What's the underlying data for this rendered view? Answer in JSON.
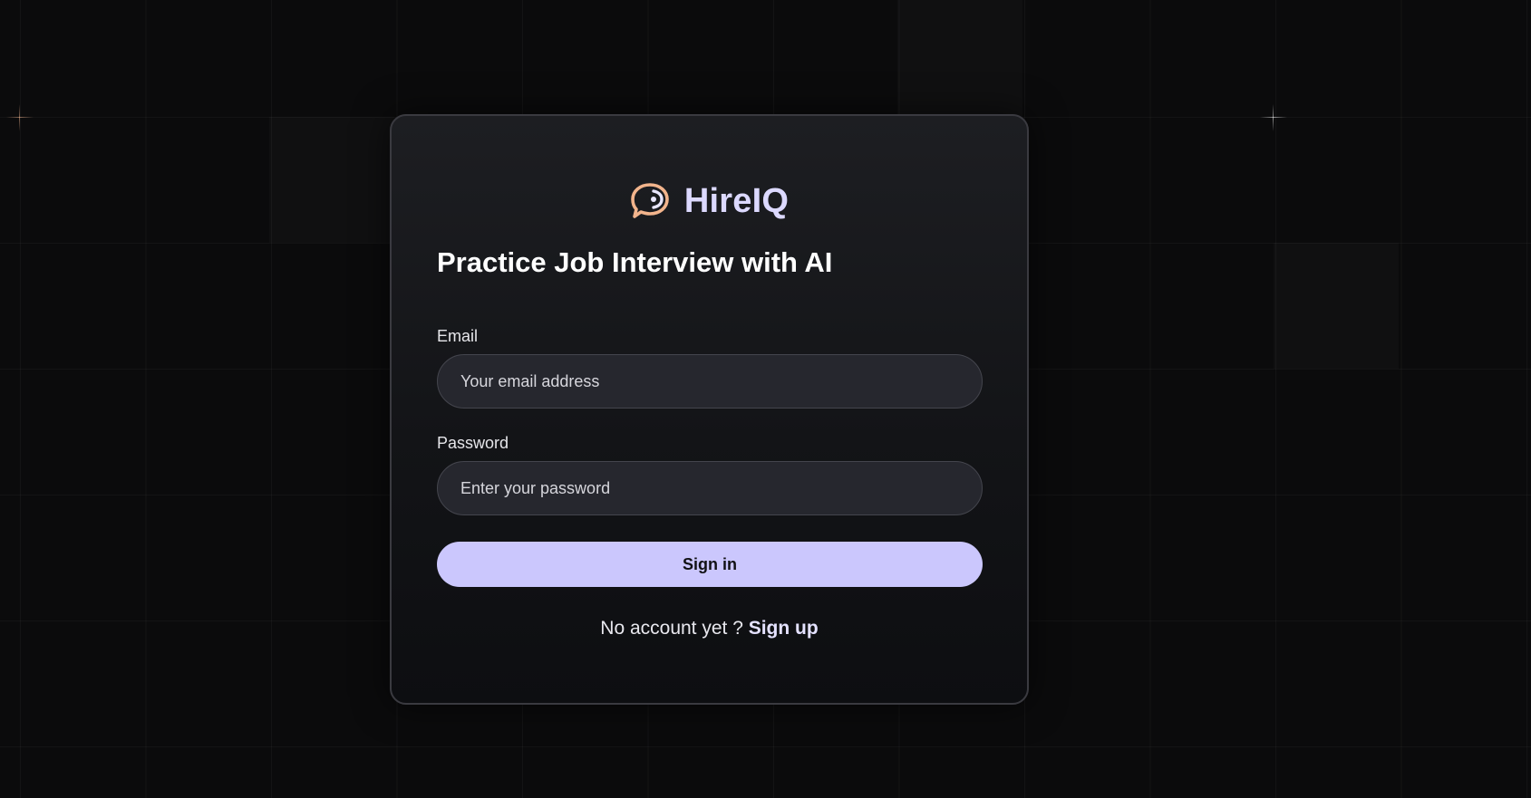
{
  "brand": {
    "name": "HireIQ",
    "logo_icon": "speech-bubble-icon",
    "logo_color": "#f2b48c",
    "name_color": "#dcd9ff"
  },
  "headline": "Practice Job Interview with AI",
  "form": {
    "email_label": "Email",
    "email_placeholder": "Your email address",
    "password_label": "Password",
    "password_placeholder": "Enter your password",
    "submit_label": "Sign in"
  },
  "signup": {
    "prompt": "No account yet ?",
    "link_label": "Sign up"
  },
  "colors": {
    "accent": "#cbc7fd",
    "background": "#0b0b0c",
    "card": "#1a1b1f"
  }
}
